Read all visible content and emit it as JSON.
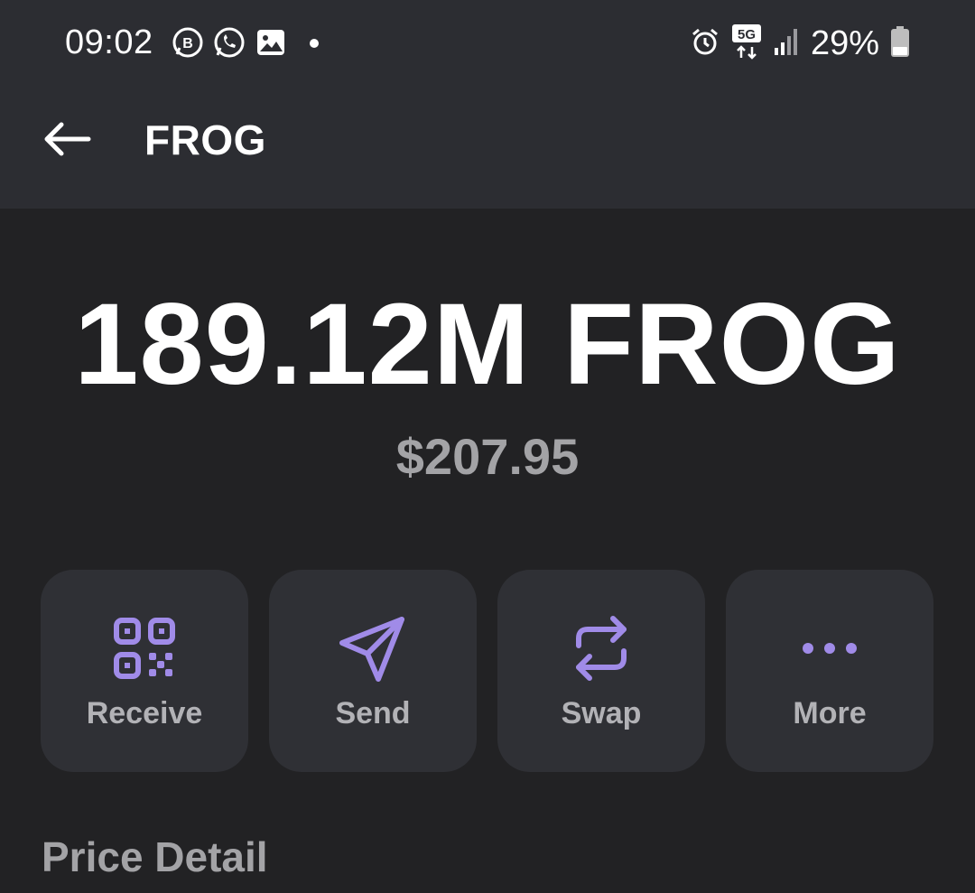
{
  "status_bar": {
    "time": "09:02",
    "left_icons": [
      "business-chat-icon",
      "whatsapp-icon",
      "gallery-icon",
      "dot-indicator-icon"
    ],
    "right_icons": [
      "alarm-icon",
      "5g-data-icon",
      "signal-icon"
    ],
    "network": "5G",
    "battery_percent": "29%"
  },
  "header": {
    "title": "FROG"
  },
  "balance": {
    "amount": "189.12M FROG",
    "fiat_value": "$207.95"
  },
  "actions": [
    {
      "label": "Receive",
      "icon": "qr-code-icon"
    },
    {
      "label": "Send",
      "icon": "send-icon"
    },
    {
      "label": "Swap",
      "icon": "swap-icon"
    },
    {
      "label": "More",
      "icon": "more-dots-icon"
    }
  ],
  "sections": {
    "price_detail_title": "Price Detail"
  },
  "colors": {
    "accent": "#a08be8",
    "background": "#222224",
    "header_bg": "#2c2d32",
    "card_bg": "#2f3035",
    "muted_text": "#a3a3a6"
  }
}
